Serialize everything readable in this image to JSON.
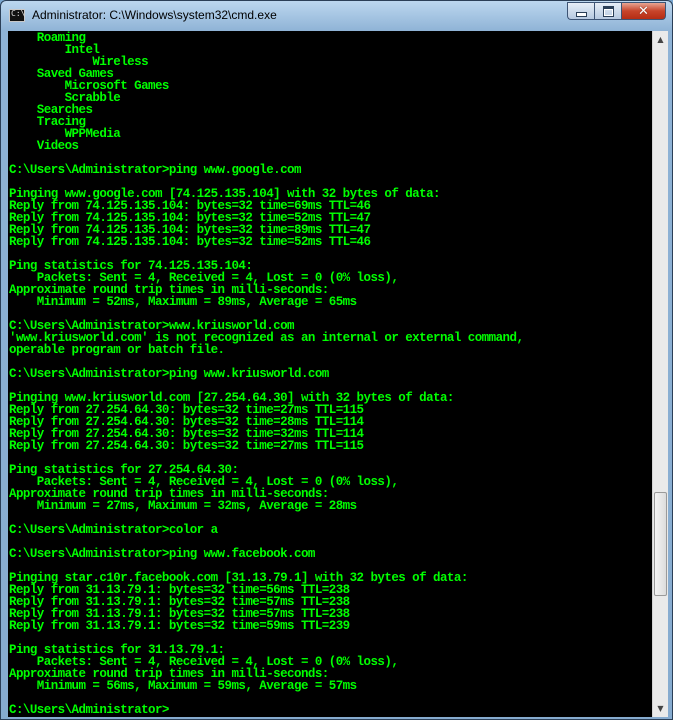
{
  "window": {
    "title": "Administrator: C:\\Windows\\system32\\cmd.exe",
    "icon_label": "C:\\",
    "controls": [
      "minimize-icon",
      "maximize-icon",
      "close-icon"
    ]
  },
  "colors": {
    "background": "#000000",
    "text": "#00ff00",
    "frame": "#86abcf"
  },
  "scrollbar": {
    "thumb_position": 0.81,
    "thumb_fraction": 0.16
  },
  "console": {
    "lines": [
      "    Roaming",
      "        Intel",
      "            Wireless",
      "    Saved Games",
      "        Microsoft Games",
      "        Scrabble",
      "    Searches",
      "    Tracing",
      "        WPPMedia",
      "    Videos",
      "",
      "C:\\Users\\Administrator>ping www.google.com",
      "",
      "Pinging www.google.com [74.125.135.104] with 32 bytes of data:",
      "Reply from 74.125.135.104: bytes=32 time=69ms TTL=46",
      "Reply from 74.125.135.104: bytes=32 time=52ms TTL=47",
      "Reply from 74.125.135.104: bytes=32 time=89ms TTL=47",
      "Reply from 74.125.135.104: bytes=32 time=52ms TTL=46",
      "",
      "Ping statistics for 74.125.135.104:",
      "    Packets: Sent = 4, Received = 4, Lost = 0 (0% loss),",
      "Approximate round trip times in milli-seconds:",
      "    Minimum = 52ms, Maximum = 89ms, Average = 65ms",
      "",
      "C:\\Users\\Administrator>www.kriusworld.com",
      "'www.kriusworld.com' is not recognized as an internal or external command,",
      "operable program or batch file.",
      "",
      "C:\\Users\\Administrator>ping www.kriusworld.com",
      "",
      "Pinging www.kriusworld.com [27.254.64.30] with 32 bytes of data:",
      "Reply from 27.254.64.30: bytes=32 time=27ms TTL=115",
      "Reply from 27.254.64.30: bytes=32 time=28ms TTL=114",
      "Reply from 27.254.64.30: bytes=32 time=32ms TTL=114",
      "Reply from 27.254.64.30: bytes=32 time=27ms TTL=115",
      "",
      "Ping statistics for 27.254.64.30:",
      "    Packets: Sent = 4, Received = 4, Lost = 0 (0% loss),",
      "Approximate round trip times in milli-seconds:",
      "    Minimum = 27ms, Maximum = 32ms, Average = 28ms",
      "",
      "C:\\Users\\Administrator>color a",
      "",
      "C:\\Users\\Administrator>ping www.facebook.com",
      "",
      "Pinging star.c10r.facebook.com [31.13.79.1] with 32 bytes of data:",
      "Reply from 31.13.79.1: bytes=32 time=56ms TTL=238",
      "Reply from 31.13.79.1: bytes=32 time=57ms TTL=238",
      "Reply from 31.13.79.1: bytes=32 time=57ms TTL=238",
      "Reply from 31.13.79.1: bytes=32 time=59ms TTL=239",
      "",
      "Ping statistics for 31.13.79.1:",
      "    Packets: Sent = 4, Received = 4, Lost = 0 (0% loss),",
      "Approximate round trip times in milli-seconds:",
      "    Minimum = 56ms, Maximum = 59ms, Average = 57ms",
      "",
      "C:\\Users\\Administrator>"
    ]
  }
}
